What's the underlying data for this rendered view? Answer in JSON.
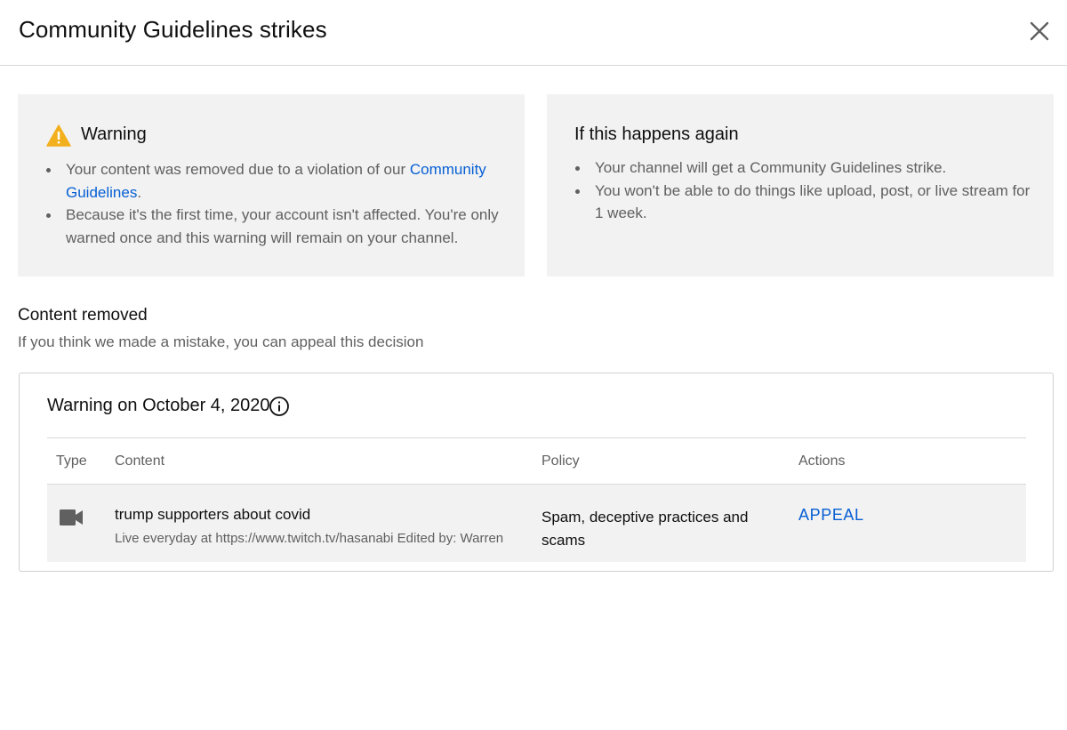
{
  "dialog": {
    "title": "Community Guidelines strikes"
  },
  "warning_card": {
    "title": "Warning",
    "bullet1_text": "Your content was removed due to a violation of our ",
    "bullet1_link": "Community Guidelines",
    "bullet1_end": ".",
    "bullet2_text": "Because it's the first time, your account isn't affected. You're only warned once and this warning will remain on your channel."
  },
  "again_card": {
    "title": "If this happens again",
    "bullets": [
      "Your channel will get a Community Guidelines strike.",
      "You won't be able to do things like upload, post, or live stream for 1 week."
    ]
  },
  "content_removed": {
    "title": "Content removed",
    "subtitle": "If you think we made a mistake, you can appeal this decision"
  },
  "strike_table": {
    "title": "Warning on October 4, 2020",
    "columns": [
      "Type",
      "Content",
      "Policy",
      "Actions"
    ],
    "rows": [
      {
        "type_icon": "video-camera-icon",
        "content_title": "trump supporters about covid",
        "content_description": "Live everyday at https://www.twitch.tv/hasanabi Edited by: Warren",
        "policy": "Spam, deceptive practices and scams",
        "action_label": "APPEAL"
      }
    ]
  },
  "colors": {
    "link": "#065fd4",
    "warning_icon": "#f2b01e",
    "card_bg": "#f2f2f2",
    "secondary_text": "#606060"
  },
  "icons": {
    "close": "close-icon",
    "warning": "warning-icon",
    "info": "info-icon"
  }
}
